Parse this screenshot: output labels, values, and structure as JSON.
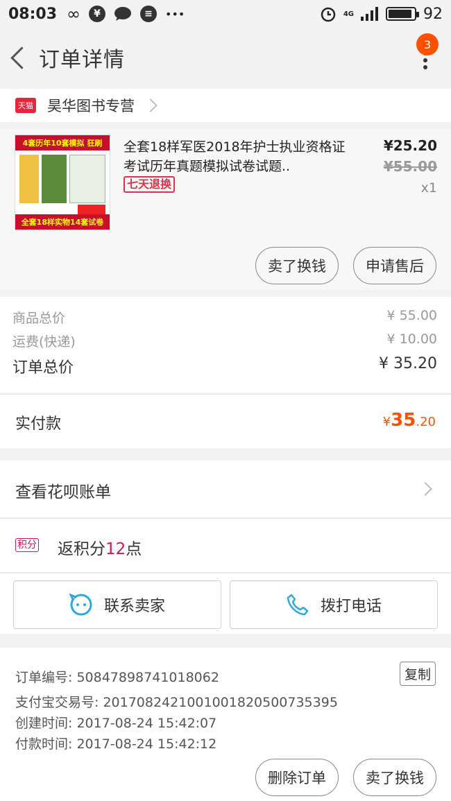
{
  "status_bar": {
    "time": "08:03",
    "yen_symbol": "¥",
    "more_dots": "•••",
    "network": "4G",
    "battery": "92"
  },
  "header": {
    "title": "订单详情",
    "badge_count": "3"
  },
  "store": {
    "tmall_label": "天猫",
    "name": "昊华图书专营"
  },
  "product": {
    "image_top_banner": "4套历年10套模拟 狂刷",
    "image_bottom_banner": "全套18样实物14套试卷",
    "title": "全套18样军医2018年护士执业资格证考试历年真题模拟试卷试题..",
    "tag": "七天退换",
    "price": "¥25.20",
    "original_price": "¥55.00",
    "quantity": "x1",
    "btn_sell": "卖了换钱",
    "btn_after_sale": "申请售后"
  },
  "summary": {
    "goods_label": "商品总价",
    "goods_value": "¥ 55.00",
    "shipping_label": "运费(快递)",
    "shipping_value": "¥ 10.00",
    "total_label": "订单总价",
    "total_value": "¥ 35.20",
    "paid_label": "实付款",
    "paid_yen": "¥",
    "paid_int": "35",
    "paid_dec": ".20"
  },
  "bill": {
    "label": "查看花呗账单"
  },
  "points": {
    "badge": "积分",
    "text_prefix": "返积分",
    "number": "12",
    "text_suffix": "点"
  },
  "contact": {
    "seller": "联系卖家",
    "call": "拨打电话"
  },
  "order_info": {
    "order_no": "订单编号: 50847898741018062",
    "copy": "复制",
    "alipay_no": "支付宝交易号: 2017082421001001820500735395",
    "created": "创建时间: 2017-08-24 15:42:07",
    "paid_time": "付款时间: 2017-08-24 15:42:12",
    "btn_delete": "删除订单",
    "btn_sell": "卖了换钱"
  },
  "colors": {
    "accent": "#ff5000",
    "tmall_red": "#e8253c",
    "points_pink": "#d4145a"
  }
}
